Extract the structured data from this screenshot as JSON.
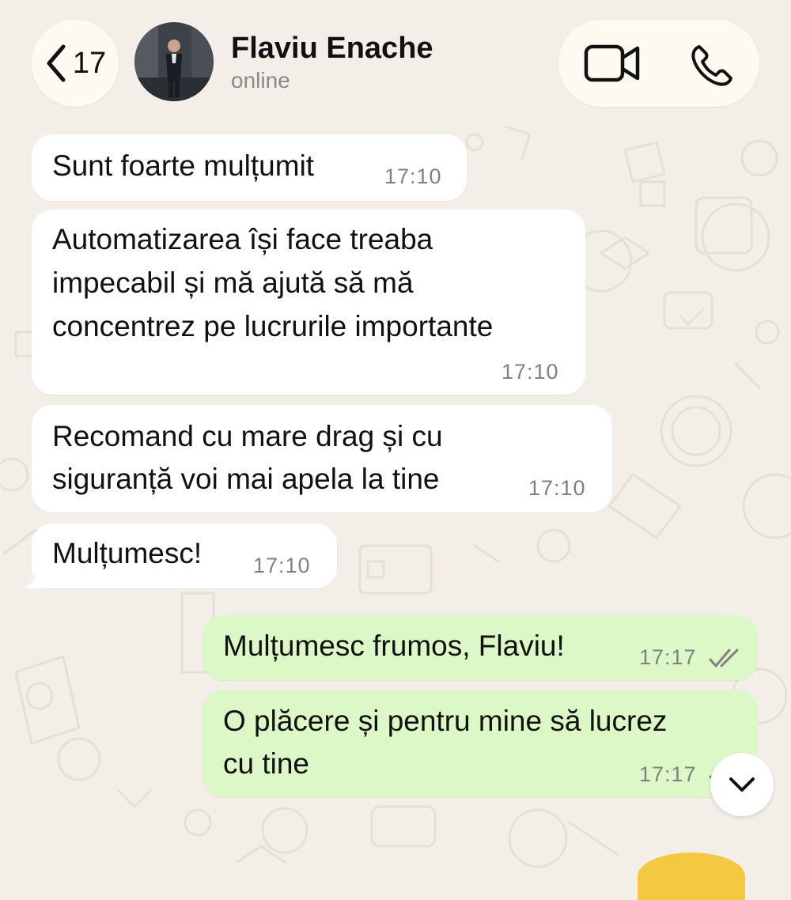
{
  "header": {
    "back_count": "17",
    "contact_name": "Flaviu Enache",
    "contact_status": "online"
  },
  "messages": [
    {
      "direction": "incoming",
      "text": "Sunt foarte mulțumit",
      "time": "17:10"
    },
    {
      "direction": "incoming",
      "lines": [
        "Automatizarea își face treaba",
        "impecabil și mă ajută să mă",
        "concentrez pe lucrurile importante"
      ],
      "time": "17:10"
    },
    {
      "direction": "incoming",
      "lines": [
        "Recomand cu mare drag și cu",
        "siguranță voi mai apela la tine"
      ],
      "time": "17:10"
    },
    {
      "direction": "incoming",
      "text": "Mulțumesc!",
      "time": "17:10"
    },
    {
      "direction": "outgoing",
      "text": "Mulțumesc frumos, Flaviu!",
      "time": "17:17",
      "status": "read"
    },
    {
      "direction": "outgoing",
      "lines": [
        "O plăcere și pentru mine să lucrez",
        "cu tine"
      ],
      "time": "17:17",
      "status": "read"
    }
  ],
  "icons": {
    "back": "chevron-left-icon",
    "video_call": "video-camera-icon",
    "voice_call": "phone-icon",
    "scroll_down": "chevron-down-icon",
    "read_receipt": "double-check-icon"
  },
  "colors": {
    "background": "#f3efe8",
    "incoming_bubble": "#ffffff",
    "outgoing_bubble": "#dcf8c6",
    "read_ticks": "#808080"
  }
}
